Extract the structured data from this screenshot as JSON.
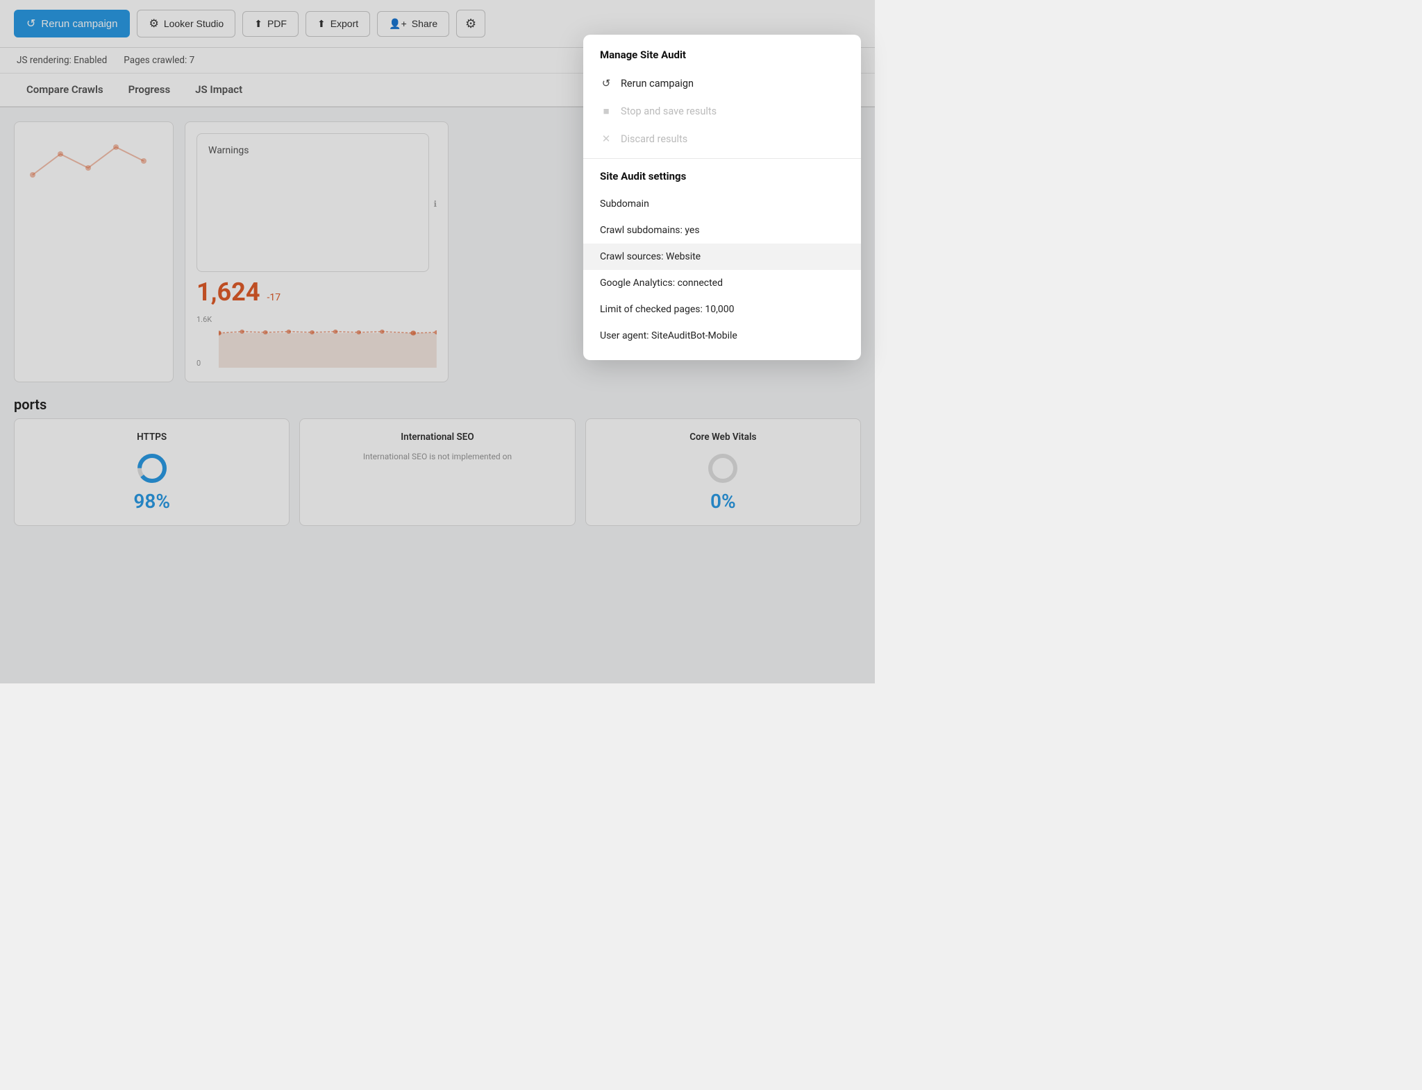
{
  "toolbar": {
    "rerun_label": "Rerun campaign",
    "looker_label": "Looker Studio",
    "pdf_label": "PDF",
    "export_label": "Export",
    "share_label": "Share"
  },
  "info_bar": {
    "js_rendering": "JS rendering: Enabled",
    "pages_crawled": "Pages crawled: 7"
  },
  "tabs": [
    {
      "label": "Compare Crawls",
      "active": false
    },
    {
      "label": "Progress",
      "active": false
    },
    {
      "label": "JS Impact",
      "active": false
    }
  ],
  "warnings_card": {
    "title": "Warnings",
    "value": "1,624",
    "diff": "-17",
    "y_label_top": "1.6K",
    "y_label_bottom": "0"
  },
  "reports_label": "ports",
  "report_cards": [
    {
      "title": "HTTPS",
      "value": "98%",
      "type": "donut"
    },
    {
      "title": "International SEO",
      "text": "International SEO is not implemented on",
      "type": "text"
    },
    {
      "title": "Core Web Vitals",
      "value": "0%",
      "type": "donut"
    }
  ],
  "manage_menu": {
    "section_title": "Manage Site Audit",
    "items": [
      {
        "label": "Rerun campaign",
        "icon": "↺",
        "disabled": false
      },
      {
        "label": "Stop and save results",
        "icon": "■",
        "disabled": true
      },
      {
        "label": "Discard results",
        "icon": "✕",
        "disabled": true
      }
    ]
  },
  "settings_menu": {
    "section_title": "Site Audit settings",
    "items": [
      {
        "label": "Subdomain",
        "highlighted": false
      },
      {
        "label": "Crawl subdomains: yes",
        "highlighted": false
      },
      {
        "label": "Crawl sources: Website",
        "highlighted": true
      },
      {
        "label": "Google Analytics: connected",
        "highlighted": false
      },
      {
        "label": "Limit of checked pages: 10,000",
        "highlighted": false
      },
      {
        "label": "User agent: SiteAuditBot-Mobile",
        "highlighted": false
      }
    ]
  }
}
